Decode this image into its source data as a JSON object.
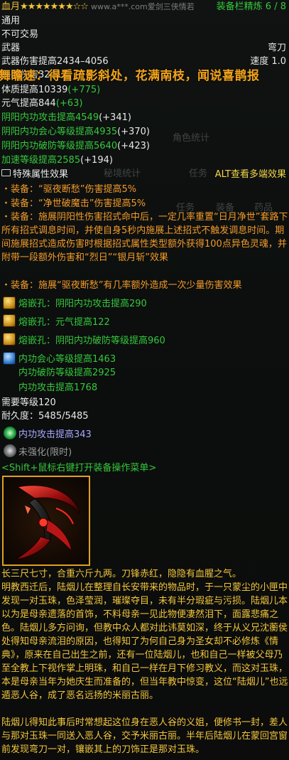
{
  "header": {
    "item_name": "血月",
    "stars": "★★★★★★★☆☆",
    "watermark": "www.a***.com爱剑三侠情若",
    "refine": "装备栏精炼 6 / 8"
  },
  "basic": {
    "usage": "通用",
    "trade": "不可交易",
    "type": "武器",
    "subtype": "弯刀",
    "damage": "武器伤害提高2434–4056",
    "speed": "速度 1.0",
    "attack_partial": "阴阳伤害3241"
  },
  "overlay_text": "舞瞻速：得看疏影斜处，花满南枝，闻说喜鹊报",
  "attributes": [
    {
      "label": "体质提高10339",
      "bonus": "(+775)"
    },
    {
      "label": "元气提高844",
      "bonus": "(+63)"
    },
    {
      "label": "阴阳内功攻击提高4549",
      "bonus": "(+341)"
    },
    {
      "label": "阴阳内功会心等级提高4935",
      "bonus": "(+370)"
    },
    {
      "label": "阴阳内功破防等级提高5640",
      "bonus": "(+423)"
    },
    {
      "label": "加速等级提高2585",
      "bonus": "(+194)"
    }
  ],
  "ghost_tabs": {
    "role_stats": "角色统计",
    "secret_stats": "秘境统计",
    "task": "任务",
    "equip": "装备",
    "drug": "药品"
  },
  "special": {
    "header": "特殊属性效果",
    "alt_hint": "ALT查看多端效果",
    "effects": [
      "・装备：“驱夜断愁”伤害提高5%",
      "・装备：“净世破魔击”伤害提高5%",
      "・装备：施展阴阳性伤害招式命中后，一定几率重置“日月净世”套路下所有招式调息时间，并使自身5秒内施展上述招式不触发调息时间。期间施展招式造成伤害时根据招式属性类型额外获得100点异色灵魂，并附带一段额外伤害和“烈日”“银月斩”效果",
      "・装备：施展“驱夜断愁”有几率额外造成一次少量伤害效果"
    ]
  },
  "inlay": [
    "熔嵌孔：阴阳内功攻击提高290",
    "熔嵌孔：元气提高122",
    "熔嵌孔：阴阳内功破防等级提高960"
  ],
  "enchant": [
    "内功会心等级提高1463",
    "内功破防等级提高2925",
    "内功攻击提高1768"
  ],
  "requirements": {
    "level": "需要等级120",
    "durability": "耐久度：5485/5485"
  },
  "extra": {
    "enhance": "内功攻击提高343",
    "not_strengthened": "未强化(限时)",
    "shift_hint": "<Shift+鼠标右键打开装备操作菜单>"
  },
  "description": {
    "p1": "长三尺七寸，合重六斤九两。刀锋赤红，隐隐有血腥之气。",
    "p2": "明教西迁后，陆烟儿在整理自长安带来的物品时，于一只蒙尘的小匣中发现一对玉珠，色泽莹润，璀璨夺目，未有半分瑕疵与污损。陆烟儿本以为是母亲遗落的首饰，不料母亲一见此物便凄然泪下，面露悲痛之色。陆烟儿多方问询，但教中众人都对此讳莫如深，终于从义兄沈蘅侯处得知母亲流泪的原因，也得知了为何自己身为圣女却不必修炼《情典》，原来在自己出生之前，还有一位陆烟儿，也和自己一样被父母乃至全教上下视作掌上明珠，和自己一样在月下修习教义，而这对玉珠，本是母亲当年为她庆生而准备的，但当年教中惊变，这位“陆烟儿”也远遁恶人谷，成了恶名远扬的米丽古丽。",
    "p3": "陆烟儿得知此事后时常想起这位身在恶人谷的义姐，便修书一封，差人与那对玉珠一同送入恶人谷，交予米丽古丽。半年后陆烟儿在蒙回宫窗前发现弯刀一对，镶嵌其上的刀饰正是那对玉珠。"
  },
  "colors": {
    "gold": "#f2c43a",
    "green": "#36c83c",
    "orange": "#f29a2a",
    "blue": "#6aa7ff",
    "lavender": "#a9a7ff",
    "white": "#e8e8e8"
  }
}
